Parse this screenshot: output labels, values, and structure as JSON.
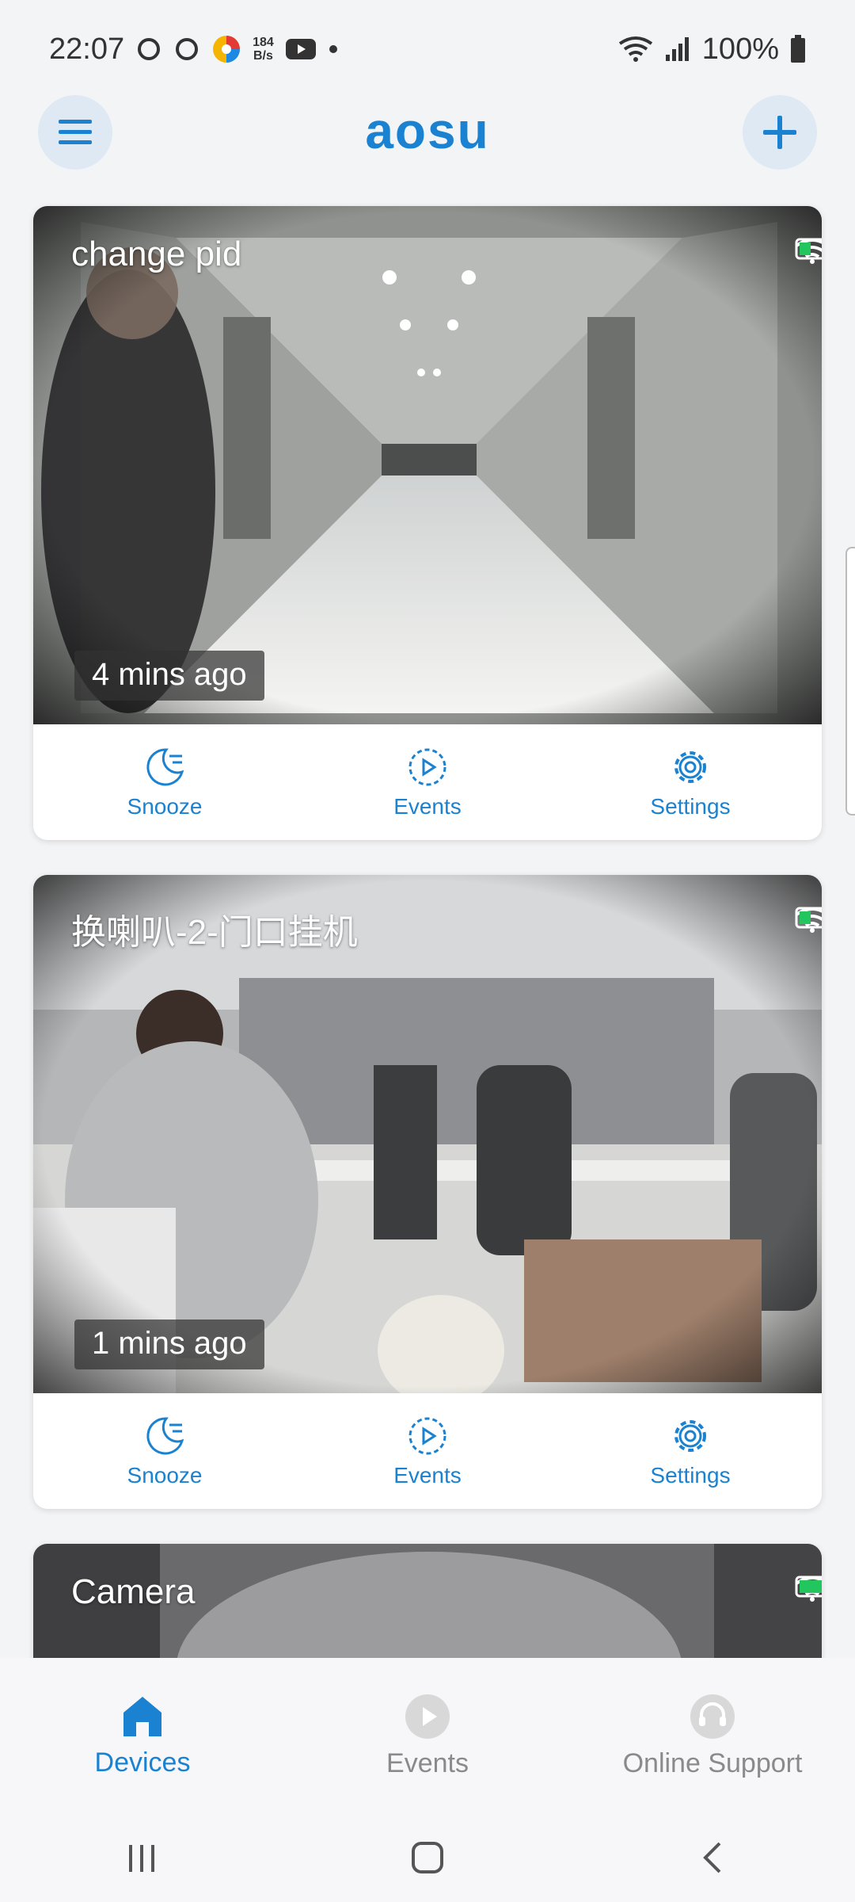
{
  "status_bar": {
    "time": "22:07",
    "net_speed_value": "184",
    "net_speed_unit": "B/s",
    "battery": "100%"
  },
  "app_bar": {
    "logo": "aosu"
  },
  "cameras": [
    {
      "name": "change pid",
      "last_event": "4 mins ago"
    },
    {
      "name": "换喇叭-2-门口挂机",
      "last_event": "1 mins ago"
    },
    {
      "name": "Camera"
    }
  ],
  "actions": {
    "snooze": "Snooze",
    "events": "Events",
    "settings": "Settings"
  },
  "bottom_nav": {
    "devices": "Devices",
    "events": "Events",
    "support": "Online Support"
  },
  "colors": {
    "accent": "#1a82d0",
    "battery_green": "#22c55e"
  }
}
